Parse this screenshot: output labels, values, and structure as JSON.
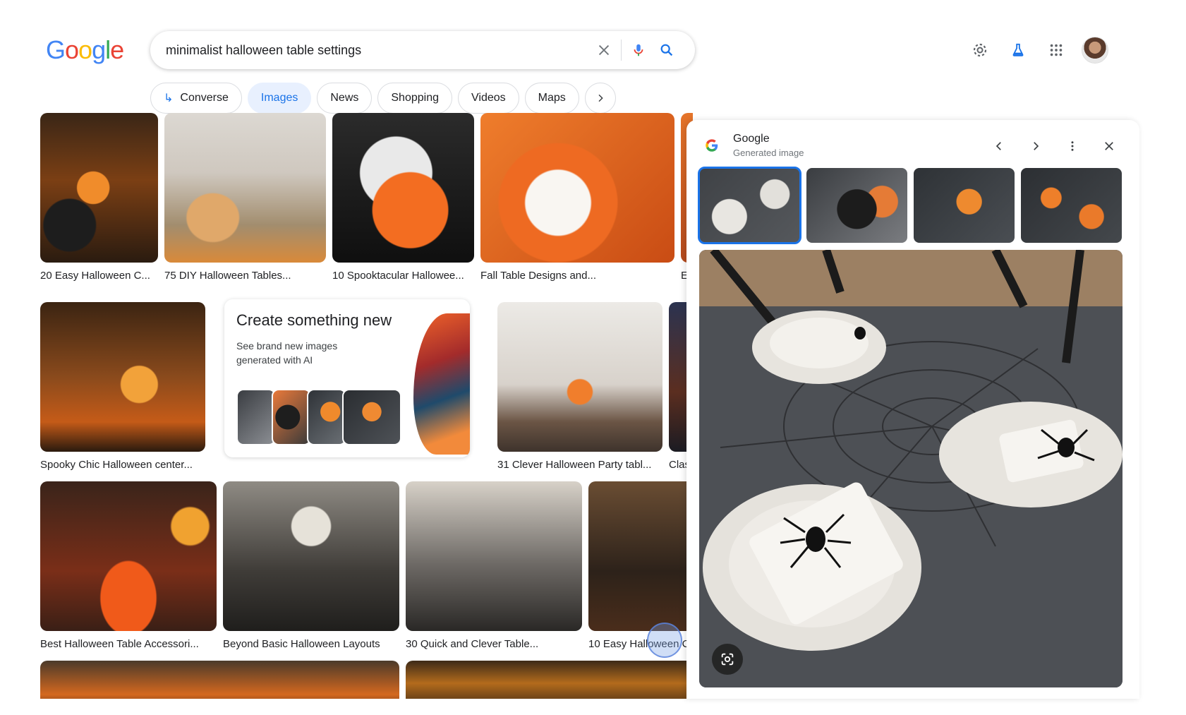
{
  "header": {
    "logo_letters": [
      "G",
      "o",
      "o",
      "g",
      "l",
      "e"
    ],
    "search_query": "minimalist halloween table settings",
    "icons": [
      "close-icon",
      "microphone-icon",
      "search-icon",
      "settings-icon",
      "labs-flask-icon",
      "apps-grid-icon"
    ]
  },
  "chips": {
    "converse": "Converse",
    "images": "Images",
    "news": "News",
    "shopping": "Shopping",
    "videos": "Videos",
    "maps": "Maps"
  },
  "results": {
    "row1": [
      "20 Easy Halloween C...",
      "75 DIY Halloween Tables...",
      "10 Spooktacular Hallowee...",
      "Fall Table Designs and...",
      "Ea"
    ],
    "row2": [
      "Spooky Chic Halloween center...",
      "31 Clever Halloween Party tabl...",
      "Clas"
    ],
    "row3": [
      "Best Halloween Table Accessori...",
      "Beyond Basic Halloween Layouts",
      "30 Quick and Clever Table...",
      "10 Easy Halloween C"
    ]
  },
  "create_card": {
    "title": "Create something new",
    "subtitle": "See brand new images generated with AI"
  },
  "panel": {
    "source_name": "Google",
    "source_subtitle": "Generated image",
    "colors": {
      "selected_outline": "#1a73e8"
    }
  },
  "colors": {
    "accent": "#1a73e8",
    "chip_active_bg": "#e8f0fe"
  }
}
